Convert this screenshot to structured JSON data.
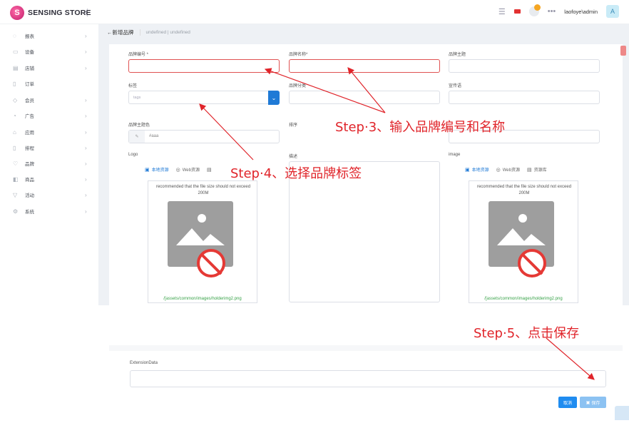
{
  "brand": {
    "name": "SENSING STORE",
    "collapse_glyph": "〈"
  },
  "topbar": {
    "username": "laofoye\\admin",
    "avatar_letter": "A"
  },
  "sidebar": {
    "items": [
      {
        "icon": "chart-icon",
        "glyph": "◌",
        "label": "报表",
        "arrow": "›"
      },
      {
        "icon": "device-icon",
        "glyph": "▭",
        "label": "设备",
        "arrow": "›"
      },
      {
        "icon": "store-icon",
        "glyph": "▤",
        "label": "店铺",
        "arrow": "›"
      },
      {
        "icon": "order-icon",
        "glyph": "▯",
        "label": "订单",
        "arrow": ""
      },
      {
        "icon": "member-icon",
        "glyph": "◇",
        "label": "会员",
        "arrow": "›"
      },
      {
        "icon": "ad-icon",
        "glyph": "◔",
        "label": "广告",
        "arrow": "›"
      },
      {
        "icon": "app-icon",
        "glyph": "⌂",
        "label": "应用",
        "arrow": "›"
      },
      {
        "icon": "schedule-icon",
        "glyph": "▯",
        "label": "排程",
        "arrow": "›"
      },
      {
        "icon": "brand-icon",
        "glyph": "♡",
        "label": "品牌",
        "arrow": "›"
      },
      {
        "icon": "product-icon",
        "glyph": "◧",
        "label": "商品",
        "arrow": "›"
      },
      {
        "icon": "campaign-icon",
        "glyph": "▽",
        "label": "活动",
        "arrow": "›"
      },
      {
        "icon": "system-icon",
        "glyph": "⚙",
        "label": "系统",
        "arrow": "›"
      }
    ]
  },
  "breadcrumb": {
    "back": "←新增品牌",
    "sub": "undefined | undefined"
  },
  "form": {
    "brand_code_label": "品牌编号 *",
    "brand_name_label": "品牌名称*",
    "brand_theme_label": "品牌主题",
    "tag_label": "标签",
    "tag_placeholder": "tags",
    "brand_category_label": "品牌分类",
    "slogan_label": "宣传语",
    "theme_color_label": "品牌主题色",
    "theme_color_value": "#aaa",
    "sort_label": "排序",
    "logo_label": "Logo",
    "desc_label": "描述",
    "image_label": "image",
    "tabs": {
      "local": "本地资源",
      "web": "Web资源",
      "library": "资源库"
    },
    "upload_note": "recommended that the file size should not exceed 200M",
    "placeholder_path": "/[assets/common/images/holderimg2.png",
    "extension_label": "ExtensionData",
    "cancel": "取消",
    "save": "保存"
  },
  "annotations": {
    "step3": "Step·3、输入品牌编号和名称",
    "step4": "Step·4、选择品牌标签",
    "step5": "Step·5、点击保存"
  },
  "colors": {
    "accent": "#1f7ad6",
    "annotation": "#e0242a",
    "error_border": "#e05252",
    "success_path": "#3aa34a"
  }
}
